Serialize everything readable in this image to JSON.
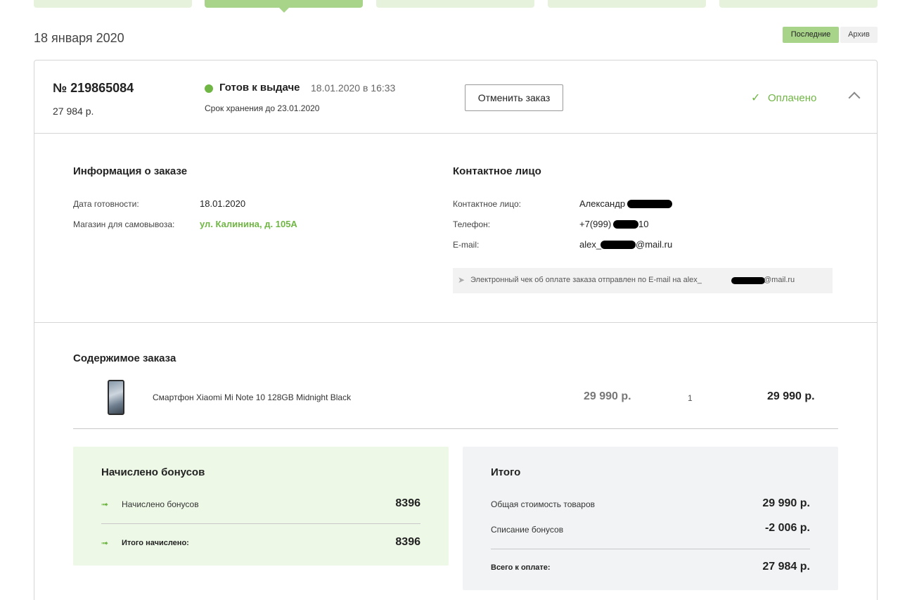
{
  "tabs": [
    {
      "id": "tab-1"
    },
    {
      "id": "tab-2",
      "active": true
    },
    {
      "id": "tab-3"
    },
    {
      "id": "tab-4"
    },
    {
      "id": "tab-5"
    }
  ],
  "date_heading": "18 января 2020",
  "filters": {
    "recent": "Последние",
    "archive": "Архив"
  },
  "order": {
    "number": "№ 219865084",
    "total": "27 984 р.",
    "status": "Готов к выдаче",
    "status_date": "18.01.2020 в 16:33",
    "storage": "Срок хранения до 23.01.2020",
    "cancel_label": "Отменить заказ",
    "paid_label": "Оплачено",
    "paid_icon": "check-icon",
    "collapse_icon": "chevron-up-icon"
  },
  "info": {
    "title": "Информация о заказе",
    "ready_label": "Дата готовности:",
    "ready_value": "18.01.2020",
    "store_label": "Магазин для самовывоза:",
    "store_value": "ул. Калинина, д. 105А"
  },
  "contact": {
    "title": "Контактное лицо",
    "person_label": "Контактное лицо:",
    "person_value": "Александр",
    "phone_label": "Телефон:",
    "phone_prefix": "+7(999)",
    "phone_suffix": "10",
    "email_label": "E-mail:",
    "email_prefix": "alex_",
    "email_suffix": "@mail.ru",
    "receipt_text": "Электронный чек об оплате заказа отправлен по E-mail на alex_",
    "receipt_suffix": "@mail.ru"
  },
  "contents": {
    "title": "Содержимое заказа",
    "item_name": "Смартфон Xiaomi Mi Note 10 128GB Midnight Black",
    "item_price": "29 990 р.",
    "item_qty": "1",
    "item_sum": "29 990 р."
  },
  "bonus": {
    "title": "Начислено бонусов",
    "accrued_label": "Начислено бонусов",
    "accrued_value": "8396",
    "total_label": "Итого начислено:",
    "total_value": "8396",
    "icon": "bonus-arrow-icon"
  },
  "summary": {
    "title": "Итого",
    "goods_label": "Общая стоимость товаров",
    "goods_value": "29 990 р.",
    "writeoff_label": "Списание бонусов",
    "writeoff_value": "-2 006 р.",
    "pay_label": "Всего к оплате:",
    "pay_value": "27 984 р."
  },
  "colors": {
    "accent": "#70b644",
    "tab_active": "#a8d48a",
    "tab": "#e6f2dc",
    "bonus_bg": "#edf8e6",
    "total_bg": "#f2f3f4"
  }
}
